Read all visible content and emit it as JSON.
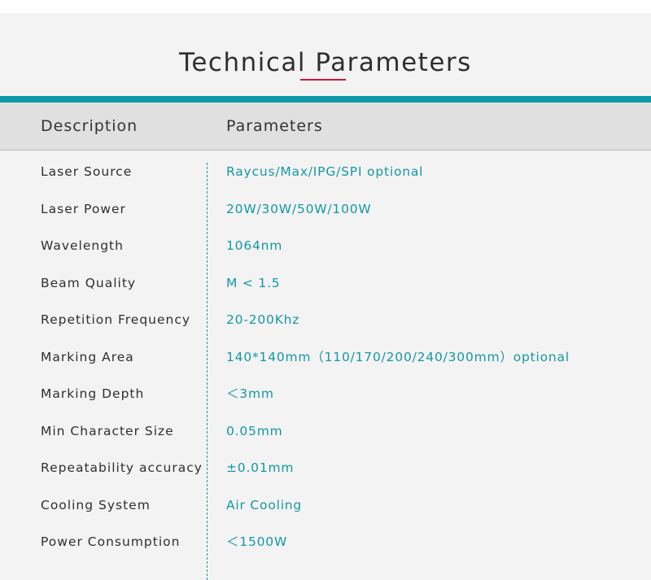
{
  "title": "Technical Parameters",
  "table": {
    "headers": {
      "description": "Description",
      "parameters": "Parameters"
    },
    "rows": [
      {
        "description": "Laser Source",
        "parameter": "Raycus/Max/IPG/SPI optional"
      },
      {
        "description": "Laser Power",
        "parameter": "20W/30W/50W/100W"
      },
      {
        "description": "Wavelength",
        "parameter": "1064nm"
      },
      {
        "description": "Beam Quality",
        "parameter": "M < 1.5"
      },
      {
        "description": "Repetition Frequency",
        "parameter": "20-200Khz"
      },
      {
        "description": "Marking Area",
        "parameter": "140*140mm（110/170/200/240/300mm）optional"
      },
      {
        "description": "Marking Depth",
        "parameter": "＜3mm"
      },
      {
        "description": "Min Character Size",
        "parameter": "0.05mm"
      },
      {
        "description": "Repeatability accuracy",
        "parameter": "±0.01mm"
      },
      {
        "description": "Cooling System",
        "parameter": "Air Cooling"
      },
      {
        "description": "Power Consumption",
        "parameter": "＜1500W"
      }
    ]
  },
  "colors": {
    "accent_teal": "#0d9aa8",
    "accent_red": "#c8163a",
    "header_bg": "#e0e0e0",
    "panel_bg": "#f3f3f3"
  }
}
